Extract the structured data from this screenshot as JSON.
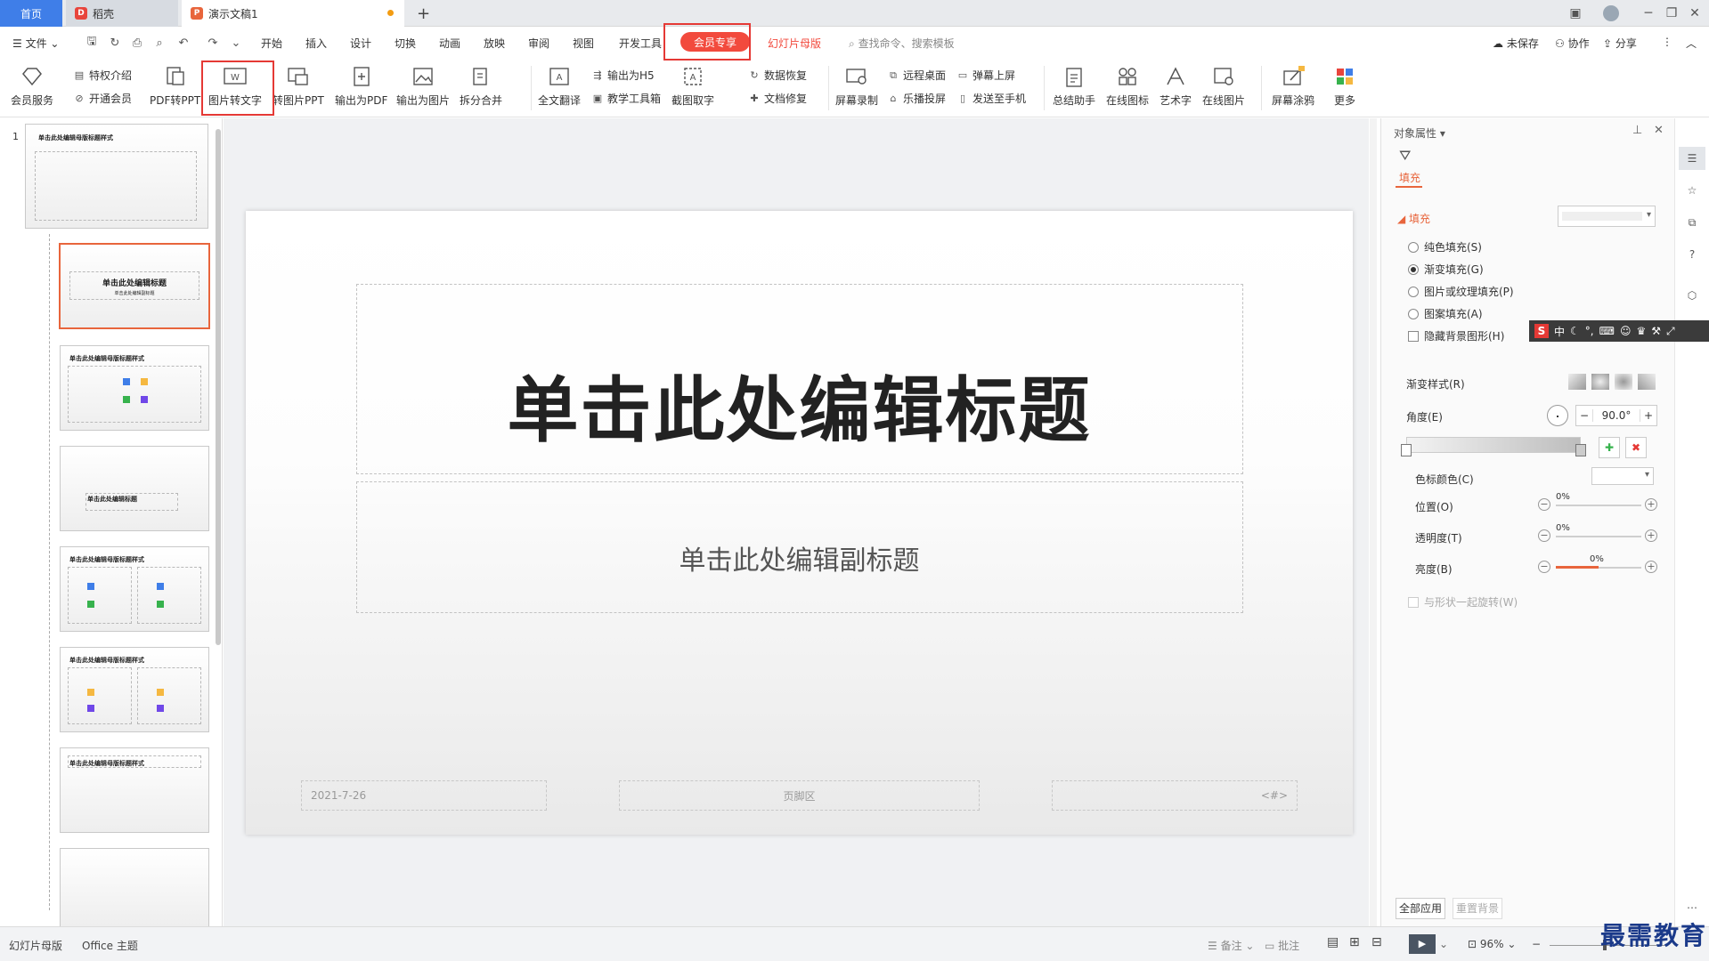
{
  "titlebar": {
    "home_tab": "首页",
    "daoke_tab": "稻壳",
    "doc_tab": "演示文稿1",
    "new_tab": "+"
  },
  "menu": {
    "file": "文件",
    "items": [
      "开始",
      "插入",
      "设计",
      "切换",
      "动画",
      "放映",
      "审阅",
      "视图",
      "开发工具"
    ],
    "vip": "会员专享",
    "master": "幻灯片母版",
    "search_placeholder": "查找命令、搜索模板",
    "unsaved": "未保存",
    "collab": "协作",
    "share": "分享"
  },
  "ribbon": {
    "member_service": "会员服务",
    "privilege_intro": "特权介绍",
    "open_member": "开通会员",
    "pdf_to_ppt": "PDF转PPT",
    "img_to_text": "图片转文字",
    "img_to_ppt": "转图片PPT",
    "export_pdf": "输出为PDF",
    "export_img": "输出为图片",
    "split_merge": "拆分合并",
    "translate": "全文翻译",
    "export_h5": "输出为H5",
    "teach_tools": "教学工具箱",
    "screenshot_text": "截图取字",
    "data_recovery": "数据恢复",
    "doc_repair": "文档修复",
    "screen_record": "屏幕录制",
    "remote_desktop": "远程桌面",
    "cast": "乐播投屏",
    "danmaku": "弹幕上屏",
    "send_phone": "发送至手机",
    "summary": "总结助手",
    "online_icon": "在线图标",
    "wordart": "艺术字",
    "online_pic": "在线图片",
    "screen_paint": "屏幕涂鸦",
    "more": "更多"
  },
  "thumbs": {
    "num1": "1",
    "t1": "单击此处编辑母版标题样式",
    "t2": "单击此处编辑标题",
    "t2sub": "单击此处编辑副标题",
    "t3": "单击此处编辑母版标题样式",
    "t4": "单击此处编辑标题",
    "t5": "单击此处编辑母版标题样式",
    "t6": "单击此处编辑母版标题样式",
    "t7": "单击此处编辑母版标题样式"
  },
  "slide": {
    "title": "单击此处编辑标题",
    "subtitle": "单击此处编辑副标题",
    "date": "2021-7-26",
    "footer": "页脚区",
    "page": "<#>"
  },
  "panel": {
    "header": "对象属性",
    "tab_fill": "填充",
    "section_fill": "填充",
    "solid": "纯色填充(S)",
    "gradient": "渐变填充(G)",
    "picture": "图片或纹理填充(P)",
    "pattern": "图案填充(A)",
    "hide_bg": "隐藏背景图形(H)",
    "gradient_style": "渐变样式(R)",
    "angle": "角度(E)",
    "angle_value": "90.0°",
    "stop_color": "色标颜色(C)",
    "position": "位置(O)",
    "position_value": "0%",
    "transparency": "透明度(T)",
    "transparency_value": "0%",
    "brightness": "亮度(B)",
    "brightness_value": "0%",
    "rotate_with_shape": "与形状一起旋转(W)",
    "apply_all": "全部应用",
    "reset_bg": "重置背景"
  },
  "status": {
    "master": "幻灯片母版",
    "theme": "Office 主题",
    "notes": "备注",
    "comments": "批注",
    "zoom": "96%"
  },
  "ime": {
    "lang": "中"
  },
  "watermark": "最需教育",
  "colors": {
    "accent": "#3f7ee8",
    "vip": "#f24a3d",
    "highlight": "#e53935",
    "master_tab": "#f24a3d"
  }
}
